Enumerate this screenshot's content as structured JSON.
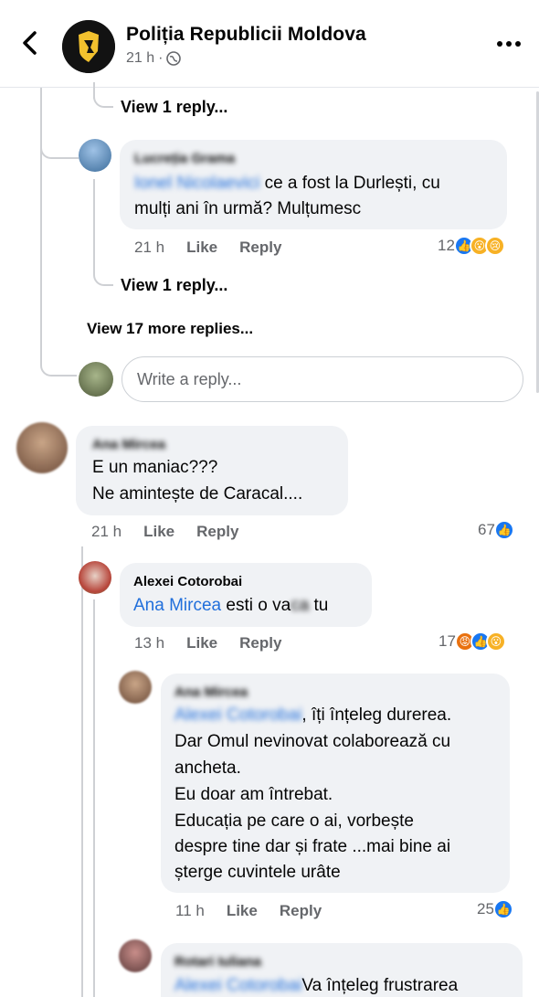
{
  "header": {
    "page_name": "Poliția Republicii Moldova",
    "time": "21 h",
    "separator": "·"
  },
  "thread": {
    "view_reply_1": "View 1 reply...",
    "comment_lucretia": {
      "author": "Lucreția Grama",
      "mention": "Ionel Nicolaevici",
      "line1": " ce a fost la Durlești, cu",
      "line2": "mulți ani în urmă? Mulțumesc",
      "time": "21 h",
      "like": "Like",
      "reply": "Reply",
      "reaction_count": "12"
    },
    "view_reply_2": "View 1 reply...",
    "view_more": "View 17 more replies...",
    "reply_placeholder": "Write a reply..."
  },
  "comment_ana": {
    "author": "Ana Mircea",
    "line1": "E un maniac???",
    "line2": "Ne amintește de Caracal....",
    "time": "21 h",
    "like": "Like",
    "reply": "Reply",
    "reaction_count": "67"
  },
  "reply_alexei": {
    "author": "Alexei Cotorobai",
    "mention": "Ana Mircea",
    "text_a": " esti o va",
    "text_hidden": "ca",
    "text_b": " tu",
    "time": "13 h",
    "like": "Like",
    "reply": "Reply",
    "reaction_count": "17"
  },
  "reply_ana2": {
    "author": "Ana Mircea",
    "mention": "Alexei Cotorobai",
    "line1": ", îți înțeleg durerea.",
    "line2": "Dar Omul nevinovat colaborează cu",
    "line3": "ancheta.",
    "line4": "Eu doar am întrebat.",
    "line5": "Educația pe care o ai, vorbește",
    "line6": "despre tine dar și frate ...mai bine ai",
    "line7": "șterge cuvintele urâte",
    "time": "11 h",
    "like": "Like",
    "reply": "Reply",
    "reaction_count": "25"
  },
  "reply_rotari": {
    "author": "Rotari Iuliana",
    "mention": "Alexei Cotorobai",
    "text": "Va înțeleg frustrarea"
  },
  "colors": {
    "link_blue": "#216fdb",
    "like_blue": "#1877f2",
    "bubble_gray": "#f0f2f5",
    "secondary_text": "#65676b"
  }
}
